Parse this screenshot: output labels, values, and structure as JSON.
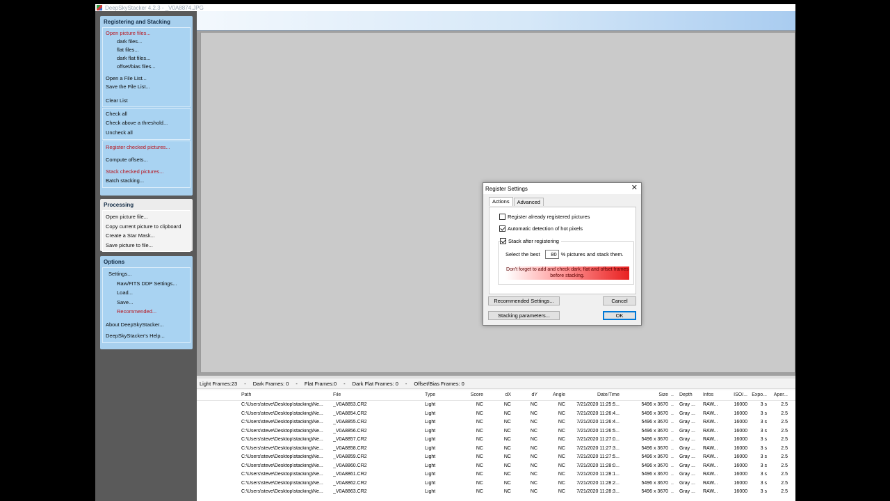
{
  "window": {
    "title": "DeepSkyStacker 4.2.3 - _V0A8874.JPG"
  },
  "sidebar": {
    "registering": {
      "title": "Registering and Stacking",
      "open_picture_files": "Open picture files...",
      "dark_files": "dark files...",
      "flat_files": "flat files...",
      "dark_flat_files": "dark flat files...",
      "offset_bias_files": "offset/bias files...",
      "open_file_list": "Open a File List...",
      "save_file_list": "Save the File List...",
      "clear_list": "Clear List",
      "check_all": "Check all",
      "check_above_threshold": "Check above a threshold...",
      "uncheck_all": "Uncheck all",
      "register_checked": "Register checked pictures...",
      "compute_offsets": "Compute offsets...",
      "stack_checked": "Stack checked pictures...",
      "batch_stacking": "Batch stacking..."
    },
    "processing": {
      "title": "Processing",
      "open_picture_file": "Open picture file...",
      "copy_to_clipboard": "Copy current picture to clipboard",
      "create_star_mask": "Create a Star Mask...",
      "save_picture": "Save picture to file..."
    },
    "options": {
      "title": "Options",
      "settings": "Settings...",
      "raw_fits": "Raw/FITS DDP Settings...",
      "load": "Load...",
      "save": "Save...",
      "recommended": "Recommended...",
      "about": "About DeepSkyStacker...",
      "help": "DeepSkyStacker's Help..."
    }
  },
  "counts": {
    "light": "Light Frames:23",
    "sep1": "-",
    "dark": "Dark Frames: 0",
    "sep2": "-",
    "flat": "Flat Frames:0",
    "sep3": "-",
    "dark_flat": "Dark Flat Frames: 0",
    "sep4": "-",
    "offset": "Offset/Bias Frames: 0"
  },
  "table": {
    "headers": {
      "path": "Path",
      "file": "File",
      "type": "Type",
      "score": "Score",
      "dx": "dX",
      "dy": "dY",
      "angle": "Angle",
      "date": "Date/Time",
      "size": "Size",
      "dot": "..",
      "depth": "Depth",
      "infos": "Infos",
      "iso": "ISO/...",
      "expo": "Expo...",
      "aper": "Aper..."
    },
    "rows": [
      {
        "path": "C:\\Users\\steve\\Desktop\\stacking\\Ne...",
        "file": "_V0A8853.CR2",
        "type": "Light",
        "score": "NC",
        "dx": "NC",
        "dy": "NC",
        "angle": "NC",
        "date": "7/21/2020 11:25:5...",
        "size": "5496 x 3670",
        "dot": "..",
        "depth": "Gray ...",
        "infos": "RAW...",
        "iso": "16000",
        "expo": "3 s",
        "aper": "2.5"
      },
      {
        "path": "C:\\Users\\steve\\Desktop\\stacking\\Ne...",
        "file": "_V0A8854.CR2",
        "type": "Light",
        "score": "NC",
        "dx": "NC",
        "dy": "NC",
        "angle": "NC",
        "date": "7/21/2020 11:26:4...",
        "size": "5496 x 3670",
        "dot": "..",
        "depth": "Gray ...",
        "infos": "RAW...",
        "iso": "16000",
        "expo": "3 s",
        "aper": "2.5"
      },
      {
        "path": "C:\\Users\\steve\\Desktop\\stacking\\Ne...",
        "file": "_V0A8855.CR2",
        "type": "Light",
        "score": "NC",
        "dx": "NC",
        "dy": "NC",
        "angle": "NC",
        "date": "7/21/2020 11:26:4...",
        "size": "5496 x 3670",
        "dot": "..",
        "depth": "Gray ...",
        "infos": "RAW...",
        "iso": "16000",
        "expo": "3 s",
        "aper": "2.5"
      },
      {
        "path": "C:\\Users\\steve\\Desktop\\stacking\\Ne...",
        "file": "_V0A8856.CR2",
        "type": "Light",
        "score": "NC",
        "dx": "NC",
        "dy": "NC",
        "angle": "NC",
        "date": "7/21/2020 11:26:5...",
        "size": "5496 x 3670",
        "dot": "..",
        "depth": "Gray ...",
        "infos": "RAW...",
        "iso": "16000",
        "expo": "3 s",
        "aper": "2.5"
      },
      {
        "path": "C:\\Users\\steve\\Desktop\\stacking\\Ne...",
        "file": "_V0A8857.CR2",
        "type": "Light",
        "score": "NC",
        "dx": "NC",
        "dy": "NC",
        "angle": "NC",
        "date": "7/21/2020 11:27:0...",
        "size": "5496 x 3670",
        "dot": "..",
        "depth": "Gray ...",
        "infos": "RAW...",
        "iso": "16000",
        "expo": "3 s",
        "aper": "2.5"
      },
      {
        "path": "C:\\Users\\steve\\Desktop\\stacking\\Ne...",
        "file": "_V0A8858.CR2",
        "type": "Light",
        "score": "NC",
        "dx": "NC",
        "dy": "NC",
        "angle": "NC",
        "date": "7/21/2020 11:27:3...",
        "size": "5496 x 3670",
        "dot": "..",
        "depth": "Gray ...",
        "infos": "RAW...",
        "iso": "16000",
        "expo": "3 s",
        "aper": "2.5"
      },
      {
        "path": "C:\\Users\\steve\\Desktop\\stacking\\Ne...",
        "file": "_V0A8859.CR2",
        "type": "Light",
        "score": "NC",
        "dx": "NC",
        "dy": "NC",
        "angle": "NC",
        "date": "7/21/2020 11:27:5...",
        "size": "5496 x 3670",
        "dot": "..",
        "depth": "Gray ...",
        "infos": "RAW...",
        "iso": "16000",
        "expo": "3 s",
        "aper": "2.5"
      },
      {
        "path": "C:\\Users\\steve\\Desktop\\stacking\\Ne...",
        "file": "_V0A8860.CR2",
        "type": "Light",
        "score": "NC",
        "dx": "NC",
        "dy": "NC",
        "angle": "NC",
        "date": "7/21/2020 11:28:0...",
        "size": "5496 x 3670",
        "dot": "..",
        "depth": "Gray ...",
        "infos": "RAW...",
        "iso": "16000",
        "expo": "3 s",
        "aper": "2.5"
      },
      {
        "path": "C:\\Users\\steve\\Desktop\\stacking\\Ne...",
        "file": "_V0A8861.CR2",
        "type": "Light",
        "score": "NC",
        "dx": "NC",
        "dy": "NC",
        "angle": "NC",
        "date": "7/21/2020 11:28:1...",
        "size": "5496 x 3670",
        "dot": "..",
        "depth": "Gray ...",
        "infos": "RAW...",
        "iso": "16000",
        "expo": "3 s",
        "aper": "2.5"
      },
      {
        "path": "C:\\Users\\steve\\Desktop\\stacking\\Ne...",
        "file": "_V0A8862.CR2",
        "type": "Light",
        "score": "NC",
        "dx": "NC",
        "dy": "NC",
        "angle": "NC",
        "date": "7/21/2020 11:28:2...",
        "size": "5496 x 3670",
        "dot": "..",
        "depth": "Gray ...",
        "infos": "RAW...",
        "iso": "16000",
        "expo": "3 s",
        "aper": "2.5"
      },
      {
        "path": "C:\\Users\\steve\\Desktop\\stacking\\Ne...",
        "file": "_V0A8863.CR2",
        "type": "Light",
        "score": "NC",
        "dx": "NC",
        "dy": "NC",
        "angle": "NC",
        "date": "7/21/2020 11:28:3...",
        "size": "5496 x 3670",
        "dot": "..",
        "depth": "Gray ...",
        "infos": "RAW...",
        "iso": "16000",
        "expo": "3 s",
        "aper": "2.5"
      }
    ]
  },
  "dialog": {
    "title": "Register Settings",
    "close": "✕",
    "tab_actions": "Actions",
    "tab_advanced": "Advanced",
    "register_already": "Register already registered pictures",
    "register_already_checked": false,
    "auto_hot_pixels": "Automatic detection of hot pixels",
    "auto_hot_pixels_checked": true,
    "stack_after": "Stack after registering",
    "stack_after_checked": true,
    "select_best": "Select the best",
    "best_value": "80",
    "pictures_and_stack": "% pictures and stack them.",
    "warning": "Don't forget to add and check dark, flat and offset frames before stacking.",
    "recommended_btn": "Recommended Settings...",
    "cancel_btn": "Cancel",
    "stacking_params_btn": "Stacking parameters...",
    "ok_btn": "OK"
  },
  "colors": {
    "sidebar_group_bg": "#a8d0ee",
    "action_red": "#b8121b",
    "warning_red": "#e82020",
    "default_button_border": "#0078d7"
  }
}
